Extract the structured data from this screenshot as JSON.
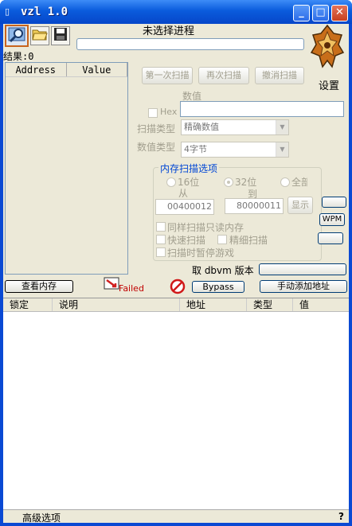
{
  "window": {
    "title": "vzl 1.0",
    "app_icon": "app-icon",
    "minimize_glyph": "_",
    "maximize_glyph": "□",
    "close_glyph": "✕"
  },
  "toolbar": {
    "open_process_icon": "magnifier-computer-icon",
    "open_file_icon": "folder-open-icon",
    "save_icon": "floppy-disk-icon"
  },
  "process_title": "未选择进程",
  "results_label": "结果:0",
  "settings_label": "设置",
  "address_list": {
    "columns": [
      "Address",
      "Value"
    ]
  },
  "scan_buttons": {
    "first_scan": "第一次扫描",
    "next_scan": "再次扫描",
    "undo_scan": "撤消扫描"
  },
  "value_label": "数值",
  "hex_label": "Hex",
  "scan_type": {
    "label": "扫描类型",
    "selected": "精确数值"
  },
  "value_type": {
    "label": "数值类型",
    "selected": "4字节"
  },
  "memory_scan": {
    "title": "内存扫描选项",
    "opt_16bit": "16位",
    "opt_32bit": "32位",
    "opt_all": "全部",
    "from_label": "从",
    "to_label": "到",
    "from_value": "00400012",
    "to_value": "80000011",
    "show_button": "显示",
    "readonly_label": "同样扫描只读内存",
    "fast_scan_label": "快速扫描",
    "fine_scan_label": "精细扫描",
    "pause_label": "扫描时暂停游戏"
  },
  "wpm_button": "WPM",
  "dbvm_label": "取 dbvm 版本",
  "view_memory_button": "查看内存",
  "failed_label": "Failed",
  "bypass_button": "Bypass",
  "add_address_button": "手动添加地址",
  "table_columns": [
    "锁定",
    "说明",
    "地址",
    "类型",
    "值"
  ],
  "status": {
    "advanced": "高级选项",
    "help": "?"
  }
}
